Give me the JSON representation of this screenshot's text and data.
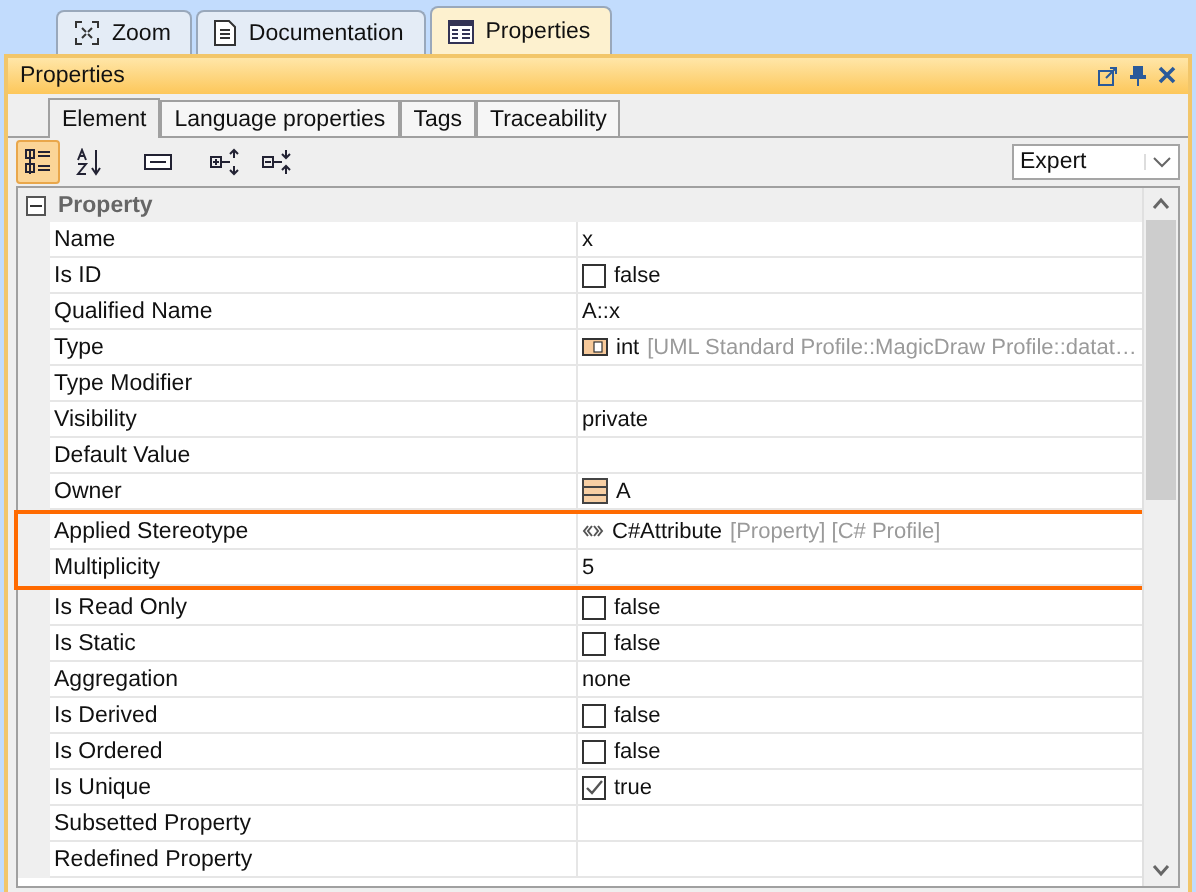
{
  "view_tabs": [
    {
      "label": "Zoom",
      "selected": false
    },
    {
      "label": "Documentation",
      "selected": false
    },
    {
      "label": "Properties",
      "selected": true
    }
  ],
  "panel": {
    "title": "Properties"
  },
  "tabs": [
    {
      "label": "Element",
      "selected": true
    },
    {
      "label": "Language properties",
      "selected": false
    },
    {
      "label": "Tags",
      "selected": false
    },
    {
      "label": "Traceability",
      "selected": false
    }
  ],
  "toolbar": [
    {
      "selected": true
    },
    {
      "selected": false
    },
    {
      "selected": false
    },
    {
      "selected": false
    },
    {
      "selected": false
    }
  ],
  "mode_select": {
    "value": "Expert"
  },
  "group": {
    "title": "Property",
    "expanded": true
  },
  "rows": [
    {
      "label": "Name",
      "kind": "text",
      "value": "x",
      "highlighted": false
    },
    {
      "label": "Is ID",
      "kind": "checkbox",
      "checked": false,
      "value": "false",
      "highlighted": false
    },
    {
      "label": "Qualified Name",
      "kind": "text",
      "value": "A::x",
      "highlighted": false
    },
    {
      "label": "Type",
      "kind": "type",
      "value": "int",
      "suffix": "[UML Standard Profile::MagicDraw Profile::datat…",
      "highlighted": false
    },
    {
      "label": "Type Modifier",
      "kind": "text",
      "value": "",
      "highlighted": false
    },
    {
      "label": "Visibility",
      "kind": "text",
      "value": "private",
      "highlighted": false
    },
    {
      "label": "Default Value",
      "kind": "text",
      "value": "",
      "highlighted": false
    },
    {
      "label": "Owner",
      "kind": "class",
      "value": "A",
      "highlighted": false
    },
    {
      "label": "Applied Stereotype",
      "kind": "stereotype",
      "value": "C#Attribute",
      "suffix": "[Property] [C# Profile]",
      "highlighted": true
    },
    {
      "label": "Multiplicity",
      "kind": "text",
      "value": "5",
      "highlighted": true
    },
    {
      "label": "Is Read Only",
      "kind": "checkbox",
      "checked": false,
      "value": "false",
      "highlighted": false
    },
    {
      "label": "Is Static",
      "kind": "checkbox",
      "checked": false,
      "value": "false",
      "highlighted": false
    },
    {
      "label": "Aggregation",
      "kind": "text",
      "value": "none",
      "highlighted": false
    },
    {
      "label": "Is Derived",
      "kind": "checkbox",
      "checked": false,
      "value": "false",
      "highlighted": false
    },
    {
      "label": "Is Ordered",
      "kind": "checkbox",
      "checked": false,
      "value": "false",
      "highlighted": false
    },
    {
      "label": "Is Unique",
      "kind": "checkbox",
      "checked": true,
      "value": "true",
      "highlighted": false
    },
    {
      "label": "Subsetted Property",
      "kind": "text",
      "value": "",
      "highlighted": false
    },
    {
      "label": "Redefined Property",
      "kind": "text",
      "value": "",
      "highlighted": false
    }
  ]
}
